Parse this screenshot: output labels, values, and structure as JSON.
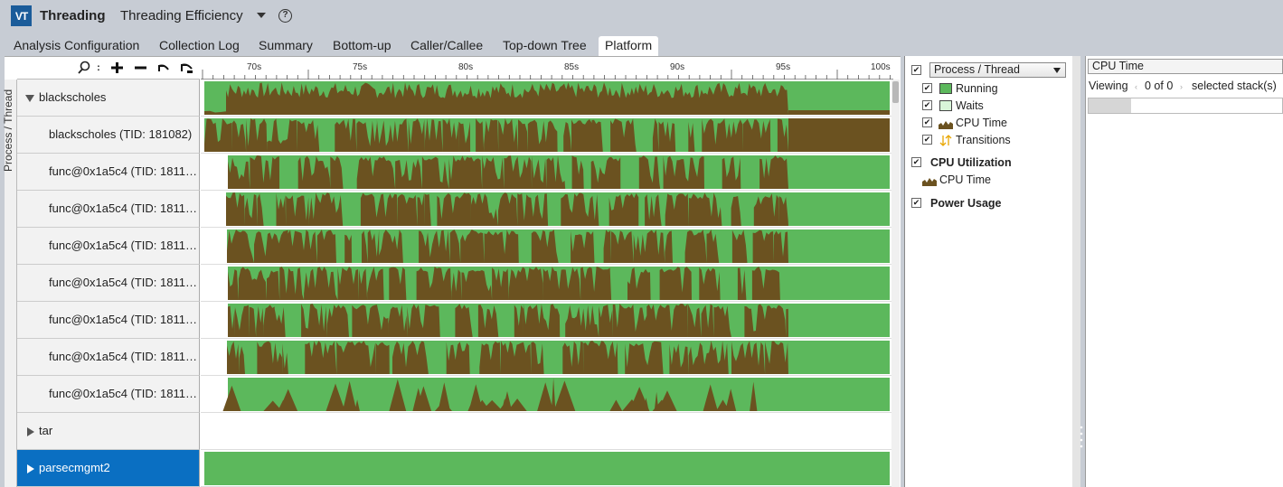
{
  "app": {
    "logo": "VT",
    "title": "Threading",
    "analysis": "Threading Efficiency",
    "help": "?"
  },
  "tabs": [
    "Analysis Configuration",
    "Collection Log",
    "Summary",
    "Bottom-up",
    "Caller/Callee",
    "Top-down Tree",
    "Platform"
  ],
  "active_tab": "Platform",
  "vertical_label": "Process / Thread",
  "ruler": {
    "ticks": [
      "70s",
      "75s",
      "80s",
      "85s",
      "90s",
      "95s",
      "100s"
    ]
  },
  "rows": [
    {
      "name": "blackscholes",
      "kind": "process",
      "expanded": true
    },
    {
      "name": "blackscholes (TID: 181082)",
      "kind": "thread"
    },
    {
      "name": "func@0x1a5c4 (TID: 1811…",
      "kind": "thread"
    },
    {
      "name": "func@0x1a5c4 (TID: 1811…",
      "kind": "thread"
    },
    {
      "name": "func@0x1a5c4 (TID: 1811…",
      "kind": "thread"
    },
    {
      "name": "func@0x1a5c4 (TID: 1811…",
      "kind": "thread"
    },
    {
      "name": "func@0x1a5c4 (TID: 1811…",
      "kind": "thread"
    },
    {
      "name": "func@0x1a5c4 (TID: 1811…",
      "kind": "thread"
    },
    {
      "name": "func@0x1a5c4 (TID: 1811…",
      "kind": "thread"
    },
    {
      "name": "tar",
      "kind": "process",
      "expanded": false
    },
    {
      "name": "parsecmgmt2",
      "kind": "process",
      "expanded": false,
      "selected": true
    }
  ],
  "legend": {
    "grouping_select": "Process / Thread",
    "items": [
      {
        "label": "Running",
        "checked": true
      },
      {
        "label": "Waits",
        "checked": true
      },
      {
        "label": "CPU Time",
        "checked": true
      },
      {
        "label": "Transitions",
        "checked": true
      }
    ],
    "cpu_utilization": {
      "label": "CPU Utilization",
      "checked": true,
      "sub": "CPU Time"
    },
    "power_usage": {
      "label": "Power Usage",
      "checked": true
    }
  },
  "right_panel": {
    "metric": "CPU Time",
    "viewing_label": "Viewing",
    "viewing_count": "0 of 0",
    "viewing_suffix": "selected stack(s)"
  },
  "colors": {
    "running": "#5cb85c",
    "waits": "#d9f5d9",
    "cpu_time": "#6b5220",
    "selection": "#0a6fc2",
    "logo": "#1b5c9a"
  }
}
